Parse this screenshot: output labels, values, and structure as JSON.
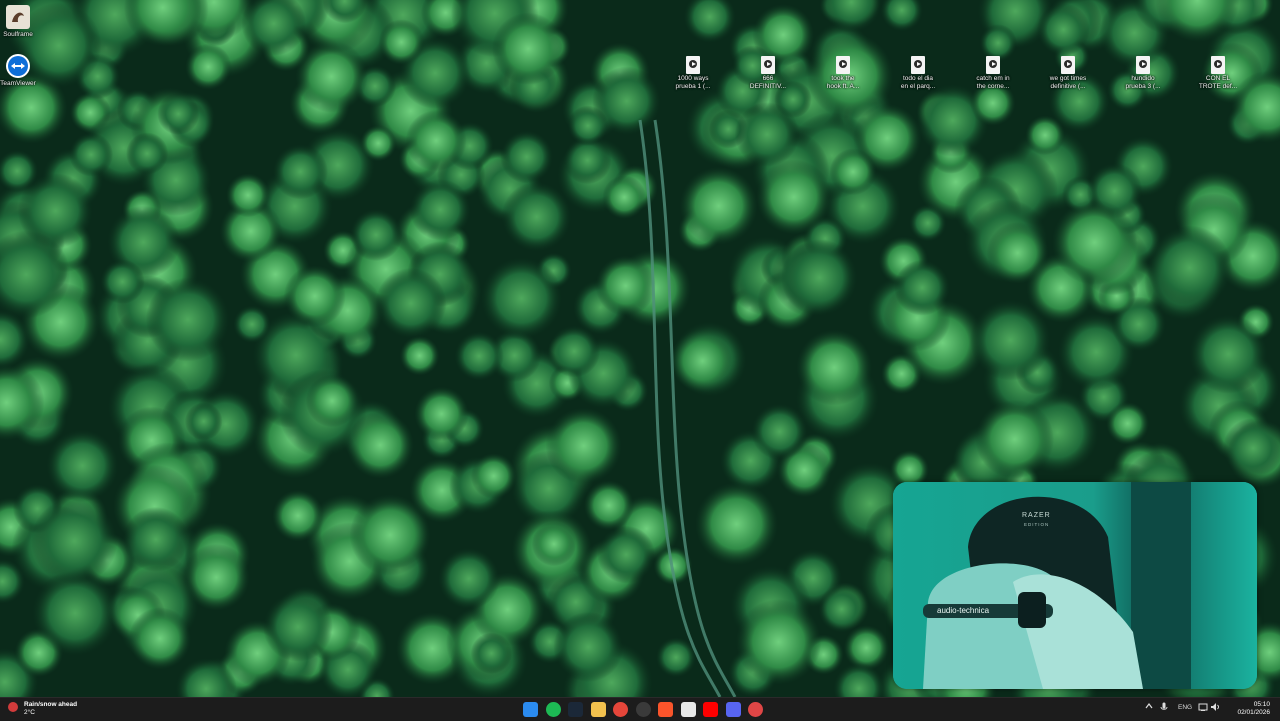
{
  "desktop": {
    "left_icons": [
      {
        "label": "Soulframe",
        "icon": "soulframe-icon"
      },
      {
        "label": "TeamViewer",
        "icon": "teamviewer-icon"
      }
    ],
    "files": [
      {
        "label": "1000 ways\nprueba 1 (...",
        "icon": "audio-file-icon"
      },
      {
        "label": "666\nDEFINITIV...",
        "icon": "audio-file-icon"
      },
      {
        "label": "took the\nhook ft. A...",
        "icon": "audio-file-icon"
      },
      {
        "label": "todo el dia\nen el parq...",
        "icon": "audio-file-icon"
      },
      {
        "label": "catch em in\nthe corne...",
        "icon": "audio-file-icon"
      },
      {
        "label": "we got times\ndefinitive (...",
        "icon": "audio-file-icon"
      },
      {
        "label": "hundido\nprueba 3 (...",
        "icon": "audio-file-icon"
      },
      {
        "label": "CON EL\nTROTE def...",
        "icon": "audio-file-icon"
      }
    ]
  },
  "webcam": {
    "chair_brand": "RAZER",
    "chair_sub": "EDITION",
    "headphone_brand": "audio-technica"
  },
  "taskbar": {
    "weather_title": "Rain/snow ahead",
    "weather_temp": "2°C",
    "apps": [
      "start-icon",
      "spotify-icon",
      "steam-icon",
      "file-explorer-icon",
      "chrome-icon",
      "obs-icon",
      "brave-icon",
      "notepad-icon",
      "youtube-icon",
      "discord-icon",
      "app-icon"
    ],
    "language": "ENG",
    "time": "05:10",
    "date": "02/01/2026"
  }
}
